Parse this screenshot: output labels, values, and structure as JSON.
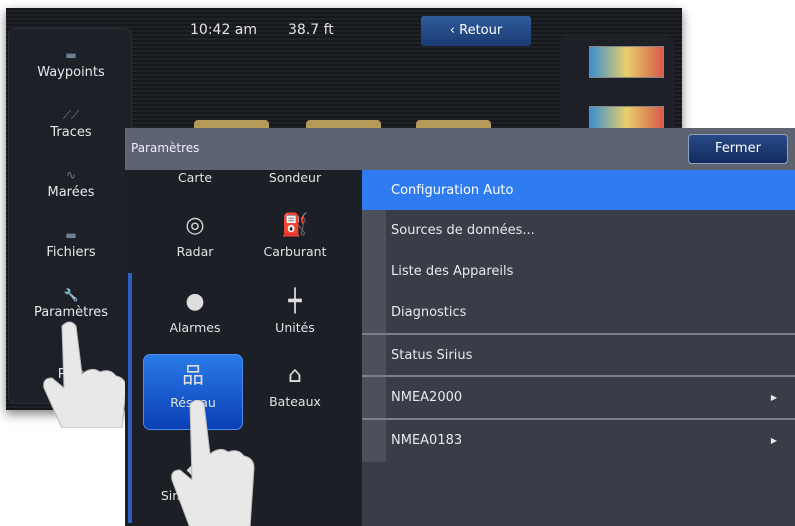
{
  "topbar": {
    "time": "10:42 am",
    "depth": "38.7 ft",
    "back_label": "Retour"
  },
  "sidebar": {
    "items": [
      {
        "label": "Waypoints"
      },
      {
        "label": "Traces"
      },
      {
        "label": "Marées"
      },
      {
        "label": "Fichiers"
      },
      {
        "label": "Paramètres"
      },
      {
        "label": "Plus"
      }
    ]
  },
  "dialog": {
    "title": "Paramètres",
    "close_label": "Fermer",
    "categories": [
      {
        "label": "Carte"
      },
      {
        "label": "Sondeur"
      },
      {
        "label": "Radar"
      },
      {
        "label": "Carburant"
      },
      {
        "label": "Alarmes"
      },
      {
        "label": "Unités"
      },
      {
        "label": "Réseau"
      },
      {
        "label": "Bateaux"
      },
      {
        "label": "Simulateur"
      }
    ],
    "menu": [
      {
        "label": "Configuration Auto"
      },
      {
        "label": "Sources de données..."
      },
      {
        "label": "Liste des Appareils"
      },
      {
        "label": "Diagnostics"
      },
      {
        "label": "Status Sirius"
      },
      {
        "label": "NMEA2000"
      },
      {
        "label": "NMEA0183"
      }
    ]
  },
  "colors": {
    "accent": "#2f7bf0",
    "header": "#5d6371"
  }
}
